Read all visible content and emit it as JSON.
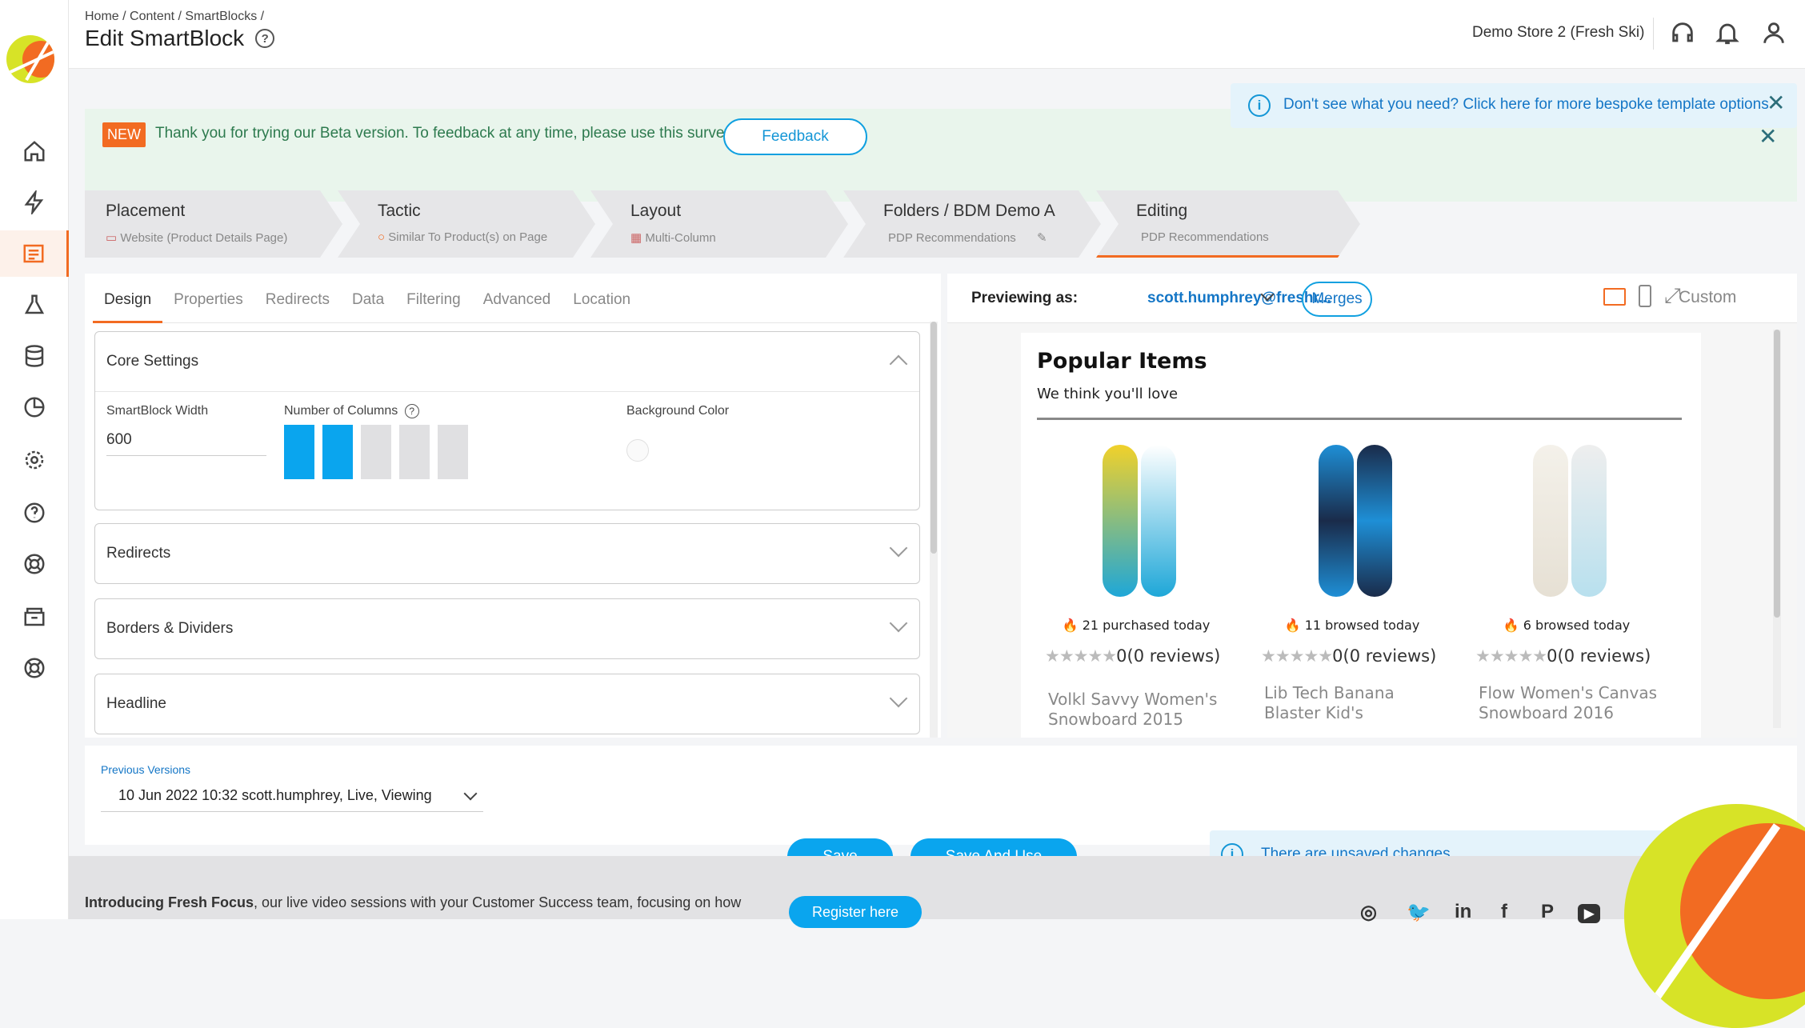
{
  "header": {
    "breadcrumb": "Home /  Content /  SmartBlocks /",
    "title": "Edit SmartBlock",
    "store": "Demo Store 2 (Fresh Ski)"
  },
  "banner": {
    "new_badge": "NEW",
    "text": "Thank you for trying our Beta version. To feedback at any time, please use this survey",
    "feedback_label": "Feedback"
  },
  "info_banner": {
    "text": "Don't see what you need? Click here for more bespoke template options"
  },
  "steps": [
    {
      "title": "Placement",
      "sub": "Website (Product Details Page)"
    },
    {
      "title": "Tactic",
      "sub": "Similar To Product(s) on Page"
    },
    {
      "title": "Layout",
      "sub": "Multi-Column"
    },
    {
      "title": "Folders / BDM Demo A",
      "sub": "PDP Recommendations"
    },
    {
      "title": "Editing",
      "sub": "PDP Recommendations"
    }
  ],
  "tabs": [
    "Design",
    "Properties",
    "Redirects",
    "Data",
    "Filtering",
    "Advanced",
    "Location"
  ],
  "core": {
    "title": "Core Settings",
    "width_label": "SmartBlock Width",
    "width_value": "600",
    "columns_label": "Number of Columns",
    "columns_selected": 2,
    "columns_total": 5,
    "bg_label": "Background Color"
  },
  "accordions": [
    "Redirects",
    "Borders & Dividers",
    "Headline"
  ],
  "preview": {
    "label": "Previewing as:",
    "user": "scott.humphrey@freshr...",
    "merges": "Merges",
    "custom": "Custom",
    "heading": "Popular Items",
    "subheading": "We think you'll love",
    "products": [
      {
        "stat": "21 purchased today",
        "rating": "0(0 reviews)",
        "name": "Volkl Savvy Women's Snowboard 2015",
        "colors": [
          "#f1d12a",
          "#1ea7d8"
        ]
      },
      {
        "stat": "11 browsed today",
        "rating": "0(0 reviews)",
        "name": "Lib Tech Banana Blaster Kid's",
        "colors": [
          "#1e8fd6",
          "#1a2b4a"
        ]
      },
      {
        "stat": "6 browsed today",
        "rating": "0(0 reviews)",
        "name": "Flow Women's Canvas Snowboard 2016",
        "colors": [
          "#eae6df",
          "#b8e0ee"
        ]
      }
    ]
  },
  "footer": {
    "prev_label": "Previous Versions",
    "prev_value": "10 Jun 2022 10:32 scott.humphrey, Live, Viewing",
    "save": "Save",
    "save_use": "Save And Use",
    "unsaved": "There are unsaved changes."
  },
  "promo": {
    "lead": "Introducing Fresh Focus",
    "text": ", our live video sessions with your Customer Success team, focusing on how",
    "register": "Register here"
  },
  "colors": {
    "accent": "#f26b22",
    "primary": "#0aa5ee",
    "brand_yellow": "#d7e327"
  }
}
